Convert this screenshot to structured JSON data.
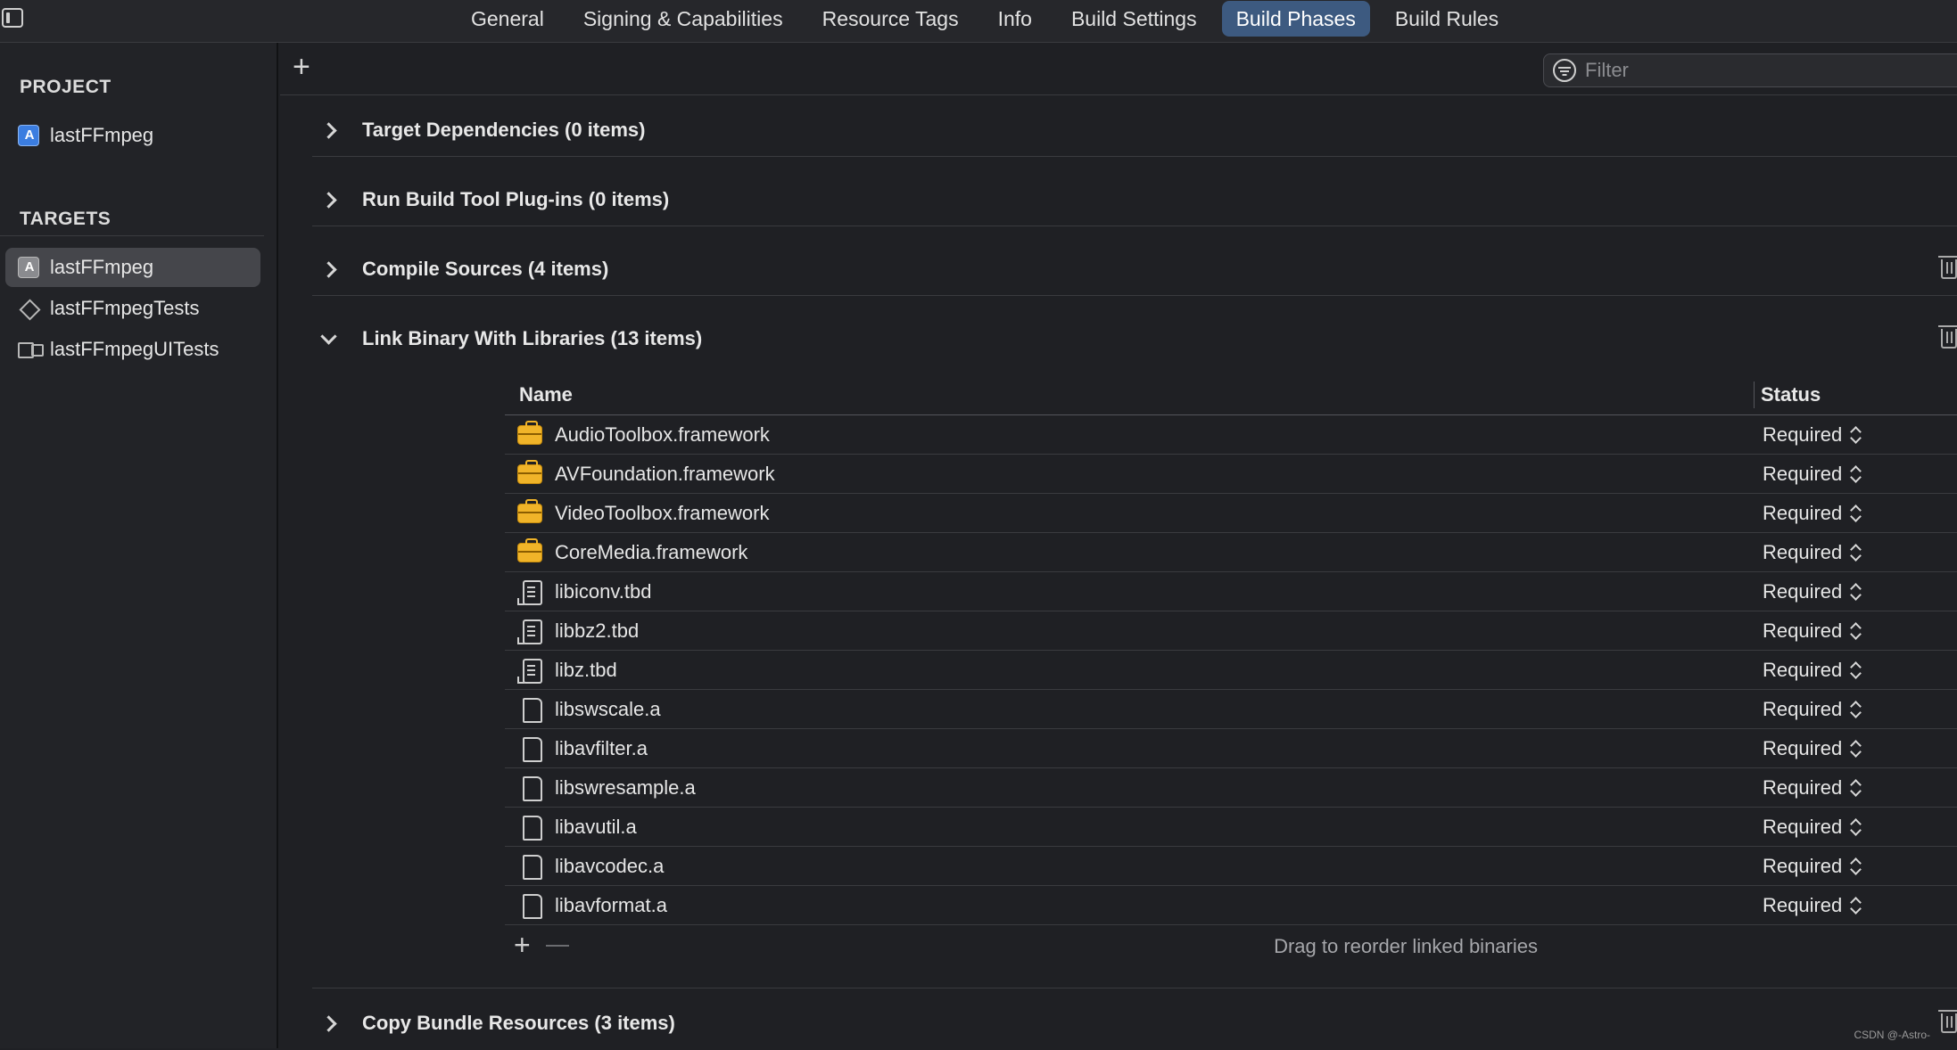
{
  "tabs": [
    {
      "label": "General"
    },
    {
      "label": "Signing & Capabilities"
    },
    {
      "label": "Resource Tags"
    },
    {
      "label": "Info"
    },
    {
      "label": "Build Settings"
    },
    {
      "label": "Build Phases",
      "active": true
    },
    {
      "label": "Build Rules"
    }
  ],
  "sidebar": {
    "project_head": "PROJECT",
    "project_item": "lastFFmpeg",
    "targets_head": "TARGETS",
    "targets": [
      {
        "label": "lastFFmpeg",
        "icon": "app-icon",
        "selected": true
      },
      {
        "label": "lastFFmpegTests",
        "icon": "unit-test-icon"
      },
      {
        "label": "lastFFmpegUITests",
        "icon": "ui-test-icon"
      }
    ]
  },
  "toolbar": {
    "add_label": "+",
    "filter_placeholder": "Filter"
  },
  "phases": {
    "target_dependencies": "Target Dependencies (0 items)",
    "build_tool_plugins": "Run Build Tool Plug-ins (0 items)",
    "compile_sources": "Compile Sources (4 items)",
    "link_binary": "Link Binary With Libraries (13 items)",
    "copy_bundle": "Copy Bundle Resources (3 items)"
  },
  "libraries": {
    "columns": {
      "name": "Name",
      "status": "Status"
    },
    "rows": [
      {
        "name": "AudioToolbox.framework",
        "status": "Required",
        "icon": "framework-icon"
      },
      {
        "name": "AVFoundation.framework",
        "status": "Required",
        "icon": "framework-icon"
      },
      {
        "name": "VideoToolbox.framework",
        "status": "Required",
        "icon": "framework-icon"
      },
      {
        "name": "CoreMedia.framework",
        "status": "Required",
        "icon": "framework-icon"
      },
      {
        "name": "libiconv.tbd",
        "status": "Required",
        "icon": "tbd-icon"
      },
      {
        "name": "libbz2.tbd",
        "status": "Required",
        "icon": "tbd-icon"
      },
      {
        "name": "libz.tbd",
        "status": "Required",
        "icon": "tbd-icon"
      },
      {
        "name": "libswscale.a",
        "status": "Required",
        "icon": "file-icon"
      },
      {
        "name": "libavfilter.a",
        "status": "Required",
        "icon": "file-icon"
      },
      {
        "name": "libswresample.a",
        "status": "Required",
        "icon": "file-icon"
      },
      {
        "name": "libavutil.a",
        "status": "Required",
        "icon": "file-icon"
      },
      {
        "name": "libavcodec.a",
        "status": "Required",
        "icon": "file-icon"
      },
      {
        "name": "libavformat.a",
        "status": "Required",
        "icon": "file-icon"
      }
    ],
    "footer_add": "+",
    "footer_hint": "Drag to reorder linked binaries"
  },
  "watermark": "CSDN @-Astro-"
}
